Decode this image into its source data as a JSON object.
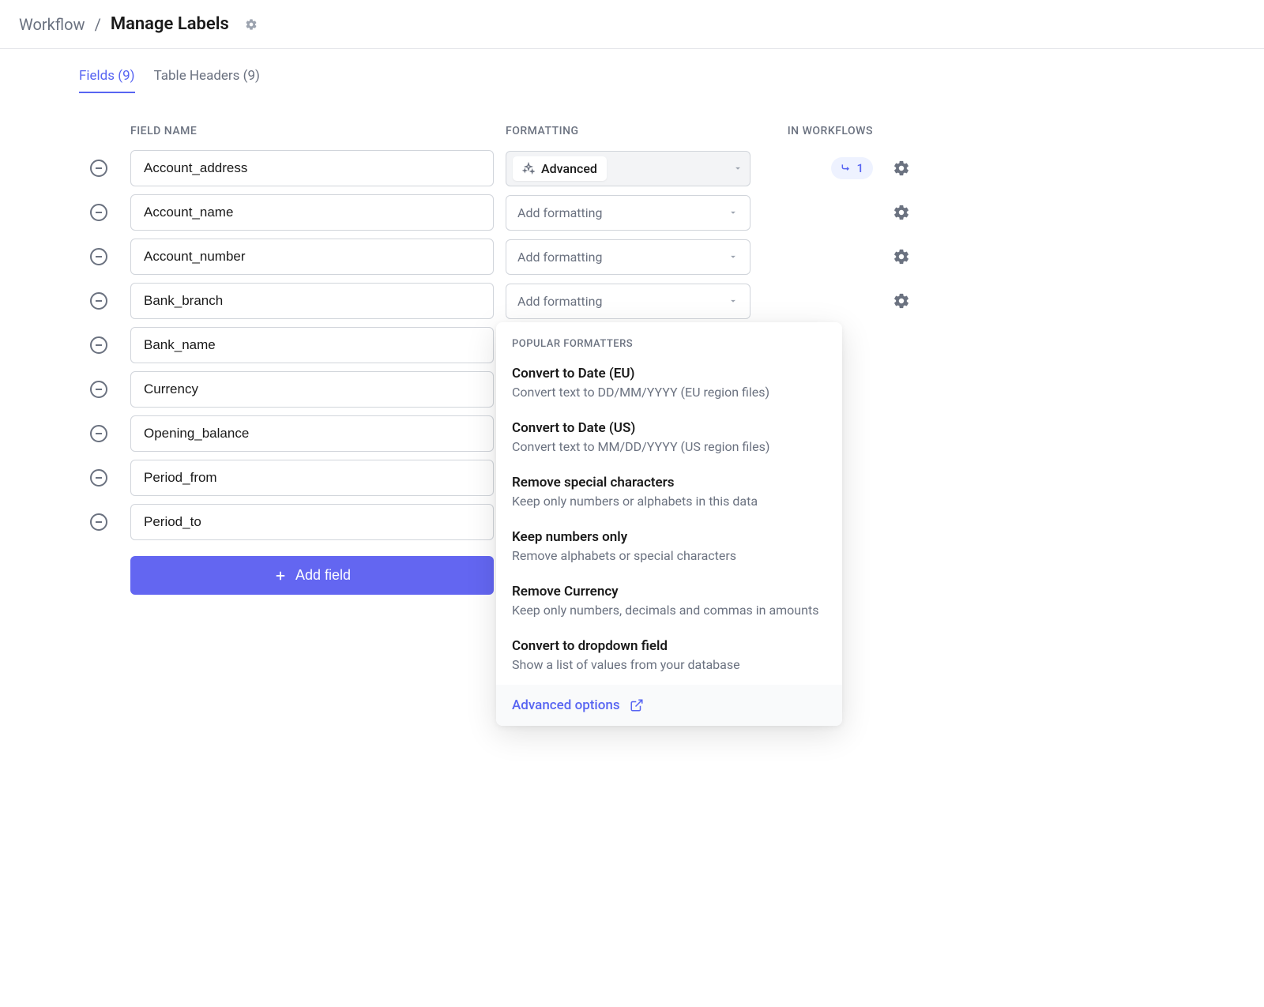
{
  "breadcrumb": {
    "root": "Workflow",
    "current": "Manage Labels"
  },
  "tabs": {
    "fields": "Fields (9)",
    "table_headers": "Table Headers (9)"
  },
  "columns": {
    "field_name": "FIELD NAME",
    "formatting": "FORMATTING",
    "in_workflows": "IN WORKFLOWS"
  },
  "placeholders": {
    "add_formatting": "Add formatting"
  },
  "advanced_label": "Advanced",
  "workflow_count": "1",
  "fields": [
    {
      "name": "Account_address",
      "formatting": "advanced",
      "workflows": 1,
      "has_gear": true
    },
    {
      "name": "Account_name",
      "formatting": "none",
      "has_gear": true
    },
    {
      "name": "Account_number",
      "formatting": "none",
      "has_gear": true
    },
    {
      "name": "Bank_branch",
      "formatting": "none",
      "has_gear": true
    },
    {
      "name": "Bank_name",
      "formatting": "popover"
    },
    {
      "name": "Currency"
    },
    {
      "name": "Opening_balance"
    },
    {
      "name": "Period_from"
    },
    {
      "name": "Period_to"
    }
  ],
  "add_field_label": "Add field",
  "popover": {
    "heading": "POPULAR FORMATTERS",
    "items": [
      {
        "title": "Convert to Date (EU)",
        "desc": "Convert text to DD/MM/YYYY (EU region files)"
      },
      {
        "title": "Convert to Date (US)",
        "desc": "Convert text to MM/DD/YYYY (US region files)"
      },
      {
        "title": "Remove special characters",
        "desc": "Keep only numbers or alphabets in this data"
      },
      {
        "title": "Keep numbers only",
        "desc": "Remove alphabets or special characters"
      },
      {
        "title": "Remove Currency",
        "desc": "Keep only numbers, decimals and commas in amounts"
      },
      {
        "title": "Convert to dropdown field",
        "desc": "Show a list of values from your database"
      }
    ],
    "footer": "Advanced options"
  }
}
